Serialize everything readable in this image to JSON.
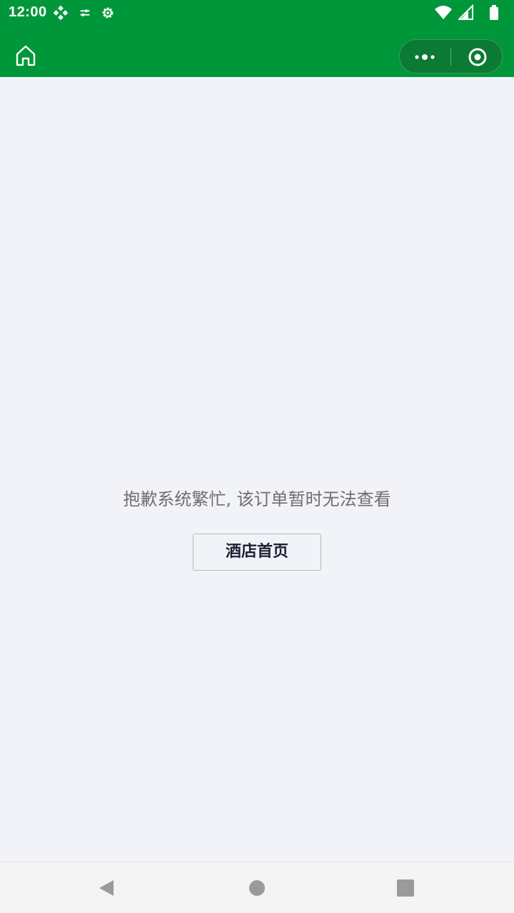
{
  "status_bar": {
    "time": "12:00",
    "left_icons": [
      "debug-icon",
      "sliders-icon",
      "gear-icon"
    ],
    "right_icons": [
      "wifi-icon",
      "signal-icon",
      "battery-icon"
    ],
    "background": "#00973a"
  },
  "nav_bar": {
    "home_icon": "home-icon",
    "capsule_icons": [
      "more-dots-icon",
      "close-target-icon"
    ],
    "background": "#00973a"
  },
  "content": {
    "message": "抱歉系统繁忙, 该订单暂时无法查看",
    "button_label": "酒店首页"
  },
  "system_nav": {
    "icons": [
      "back-icon",
      "home-circle-icon",
      "recents-icon"
    ]
  },
  "colors": {
    "brand_green": "#00973a",
    "page_background": "#f1f3f8",
    "message_text": "#6e6e6e",
    "button_text": "#1d2233"
  }
}
